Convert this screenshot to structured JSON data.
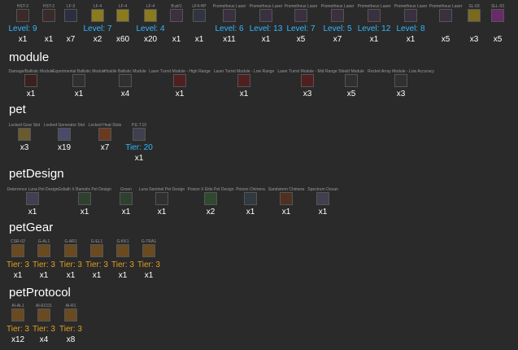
{
  "sections": {
    "top": {
      "items": [
        {
          "caption": "HST-2",
          "level": "Level: 9",
          "count": "x1",
          "color": "#3a2a2a",
          "icon": "hst-icon"
        },
        {
          "caption": "HST-2",
          "level": "",
          "count": "x1",
          "color": "#3a2a2a",
          "icon": "hst-icon"
        },
        {
          "caption": "LF-3",
          "level": "",
          "count": "x7",
          "color": "#2a3040",
          "icon": "laser-icon"
        },
        {
          "caption": "LF-4",
          "level": "Level: 7",
          "count": "x2",
          "color": "#8a7a20",
          "icon": "laser-icon"
        },
        {
          "caption": "LF-4",
          "level": "",
          "count": "x60",
          "color": "#8a7a20",
          "icon": "laser-icon"
        },
        {
          "caption": "LF-4",
          "level": "Level: 4",
          "count": "x20",
          "color": "#8a7a20",
          "icon": "laser-icon"
        },
        {
          "caption": "B-pt/1",
          "level": "",
          "count": "x1",
          "color": "#3a3040",
          "icon": "laser-icon"
        },
        {
          "caption": "LF4-HP",
          "level": "",
          "count": "x1",
          "color": "#303540",
          "icon": "laser-icon"
        },
        {
          "caption": "Prometheus Laser",
          "level": "Level: 6",
          "count": "x11",
          "color": "#3a3040",
          "icon": "laser-icon"
        },
        {
          "caption": "Prometheus Laser",
          "level": "Level: 13",
          "count": "x1",
          "color": "#3a3040",
          "icon": "laser-icon"
        },
        {
          "caption": "Prometheus Laser",
          "level": "Level: 7",
          "count": "x5",
          "color": "#3a3040",
          "icon": "laser-icon"
        },
        {
          "caption": "Prometheus Laser",
          "level": "Level: 5",
          "count": "x7",
          "color": "#3a3040",
          "icon": "laser-icon"
        },
        {
          "caption": "Prometheus Laser",
          "level": "Level: 12",
          "count": "x1",
          "color": "#3a3040",
          "icon": "laser-icon"
        },
        {
          "caption": "Prometheus Laser",
          "level": "Level: 8",
          "count": "x1",
          "color": "#3a3040",
          "icon": "laser-icon"
        },
        {
          "caption": "Prometheus Laser",
          "level": "",
          "count": "x5",
          "color": "#3a3040",
          "icon": "laser-icon"
        },
        {
          "caption": "SL-03",
          "level": "",
          "count": "x3",
          "color": "#7a6a20",
          "icon": "laser-icon"
        },
        {
          "caption": "SLL-03",
          "level": "",
          "count": "x5",
          "color": "#6a2a6a",
          "icon": "laser-icon"
        }
      ]
    },
    "module": {
      "title": "module",
      "items": [
        {
          "caption": "Damage/Ballistic Module",
          "count": "x1",
          "color": "#3a2020",
          "icon": "module-icon"
        },
        {
          "caption": "Experimental Ballistic Module",
          "count": "x1",
          "color": "#303030",
          "icon": "module-icon"
        },
        {
          "caption": "Hostile Ballistic Module",
          "count": "x4",
          "color": "#303030",
          "icon": "module-icon"
        },
        {
          "caption": "Laser Turret Module - High Range",
          "count": "x1",
          "color": "#502020",
          "icon": "module-icon"
        },
        {
          "caption": "Laser Turret Module - Low Range",
          "count": "x1",
          "color": "#502020",
          "icon": "module-icon"
        },
        {
          "caption": "Laser Turret Module - Mid Range",
          "count": "x3",
          "color": "#502020",
          "icon": "module-icon"
        },
        {
          "caption": "Shield Module",
          "count": "x5",
          "color": "#303030",
          "icon": "module-icon"
        },
        {
          "caption": "Rocket Array Module - Low Accuracy",
          "count": "x3",
          "color": "#303030",
          "icon": "module-icon"
        }
      ]
    },
    "pet": {
      "title": "pet",
      "items": [
        {
          "caption": "Locked Gear Slot",
          "level": "",
          "count": "x3",
          "color": "#6a5a30",
          "icon": "lock-icon"
        },
        {
          "caption": "Locked Generator Slot",
          "level": "",
          "count": "x19",
          "color": "#4a4a6a",
          "icon": "lock-icon"
        },
        {
          "caption": "Locked Heat Slots",
          "level": "",
          "count": "x7",
          "color": "#6a3a20",
          "icon": "lock-icon"
        },
        {
          "caption": "P.E.T.10",
          "level": "Tier: 20",
          "count": "x1",
          "color": "#404050",
          "icon": "pet-icon"
        }
      ]
    },
    "petDesign": {
      "title": "petDesign",
      "items": [
        {
          "caption": "Deterrence Luna Pet Design",
          "count": "x1",
          "color": "#404050",
          "icon": "pet-design-icon"
        },
        {
          "caption": "Goliath X Bamolix Pet Design",
          "count": "x1",
          "color": "#304030",
          "icon": "pet-design-icon"
        },
        {
          "caption": "Green",
          "count": "x1",
          "color": "#304030",
          "icon": "pet-design-icon"
        },
        {
          "caption": "Luna Sentinel Pet Design",
          "count": "x1",
          "color": "#303030",
          "icon": "pet-design-icon"
        },
        {
          "caption": "Poison X Elite Pet Design",
          "count": "x2",
          "color": "#304a30",
          "icon": "pet-design-icon"
        },
        {
          "caption": "Poison Chimera",
          "count": "x1",
          "color": "#303a40",
          "icon": "pet-design-icon"
        },
        {
          "caption": "Sandstorm Chimera",
          "count": "x1",
          "color": "#503020",
          "icon": "pet-design-icon"
        },
        {
          "caption": "Spectrum Ocean",
          "count": "x1",
          "color": "#404050",
          "icon": "pet-design-icon"
        }
      ]
    },
    "petGear": {
      "title": "petGear",
      "items": [
        {
          "caption": "CSR-02",
          "tier": "Tier: 3",
          "count": "x1",
          "color": "#6a4a20",
          "icon": "gear-icon"
        },
        {
          "caption": "G-AL1",
          "tier": "Tier: 3",
          "count": "x1",
          "color": "#6a4a20",
          "icon": "gear-icon"
        },
        {
          "caption": "G-AR1",
          "tier": "Tier: 3",
          "count": "x1",
          "color": "#6a4a20",
          "icon": "gear-icon"
        },
        {
          "caption": "G-EL1",
          "tier": "Tier: 3",
          "count": "x1",
          "color": "#6a4a20",
          "icon": "gear-icon"
        },
        {
          "caption": "G-KK1",
          "tier": "Tier: 3",
          "count": "x1",
          "color": "#6a4a20",
          "icon": "gear-icon"
        },
        {
          "caption": "G-TRA1",
          "tier": "Tier: 3",
          "count": "x1",
          "color": "#6a4a20",
          "icon": "gear-icon"
        }
      ]
    },
    "petProtocol": {
      "title": "petProtocol",
      "items": [
        {
          "caption": "AI-AL1",
          "tier": "Tier: 3",
          "count": "x12",
          "color": "#6a4a20",
          "icon": "protocol-icon"
        },
        {
          "caption": "AI-ECO1",
          "tier": "Tier: 3",
          "count": "x4",
          "color": "#6a4a20",
          "icon": "protocol-icon"
        },
        {
          "caption": "AI-R1",
          "tier": "Tier: 3",
          "count": "x8",
          "color": "#6a4a20",
          "icon": "protocol-icon"
        }
      ]
    }
  },
  "colors": {
    "background": "#2a2a2a",
    "level": "#30b8ff",
    "tier": "#e0a020",
    "caption": "#9a9a9a"
  }
}
